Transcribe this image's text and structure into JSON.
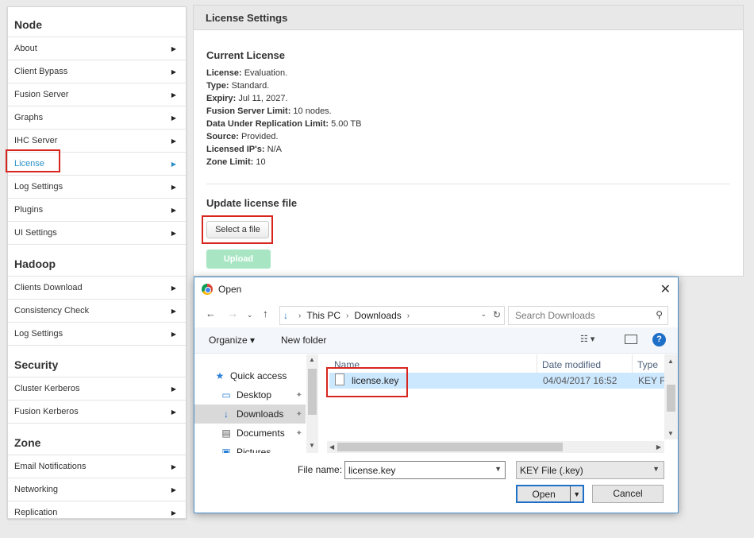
{
  "sidebar": {
    "sections": [
      {
        "title": "Node",
        "items": [
          "About",
          "Client Bypass",
          "Fusion Server",
          "Graphs",
          "IHC Server",
          "License",
          "Log Settings",
          "Plugins",
          "UI Settings"
        ]
      },
      {
        "title": "Hadoop",
        "items": [
          "Clients Download",
          "Consistency Check",
          "Log Settings"
        ]
      },
      {
        "title": "Security",
        "items": [
          "Cluster Kerberos",
          "Fusion Kerberos"
        ]
      },
      {
        "title": "Zone",
        "items": [
          "Email Notifications",
          "Networking",
          "Replication"
        ]
      }
    ],
    "active_item": "License",
    "arrow": "▶"
  },
  "main": {
    "title": "License Settings",
    "current_license_heading": "Current License",
    "fields": [
      {
        "label": "License:",
        "value": "Evaluation."
      },
      {
        "label": "Type:",
        "value": "Standard."
      },
      {
        "label": "Expiry:",
        "value": "Jul 11, 2027."
      },
      {
        "label": "Fusion Server Limit:",
        "value": "10 nodes."
      },
      {
        "label": "Data Under Replication Limit:",
        "value": "5.00 TB"
      },
      {
        "label": "Source:",
        "value": "Provided."
      },
      {
        "label": "Licensed IP's:",
        "value": "N/A"
      },
      {
        "label": "Zone Limit:",
        "value": "10"
      }
    ],
    "update_heading": "Update license file",
    "select_button": "Select a file",
    "upload_button": "Upload"
  },
  "dialog": {
    "title": "Open",
    "close": "✕",
    "breadcrumb": [
      "This PC",
      "Downloads"
    ],
    "search_placeholder": "Search Downloads",
    "organize": "Organize",
    "new_folder": "New folder",
    "nav_items": [
      {
        "label": "Quick access",
        "icon": "star-icon"
      },
      {
        "label": "Desktop",
        "icon": "desktop-icon"
      },
      {
        "label": "Downloads",
        "icon": "download-icon"
      },
      {
        "label": "Documents",
        "icon": "document-icon"
      },
      {
        "label": "Pictures",
        "icon": "pictures-icon"
      }
    ],
    "columns": {
      "name": "Name",
      "date": "Date modified",
      "type": "Type"
    },
    "file": {
      "name": "license.key",
      "date": "04/04/2017 16:52",
      "type": "KEY File"
    },
    "filename_label": "File name:",
    "filename_value": "license.key",
    "filetype_value": "KEY File (.key)",
    "open_button": "Open",
    "cancel_button": "Cancel"
  },
  "colors": {
    "accent": "#2a8fc7",
    "highlight": "#d7261e",
    "upload": "#a8e6c3",
    "selected_row": "#cce8ff"
  }
}
